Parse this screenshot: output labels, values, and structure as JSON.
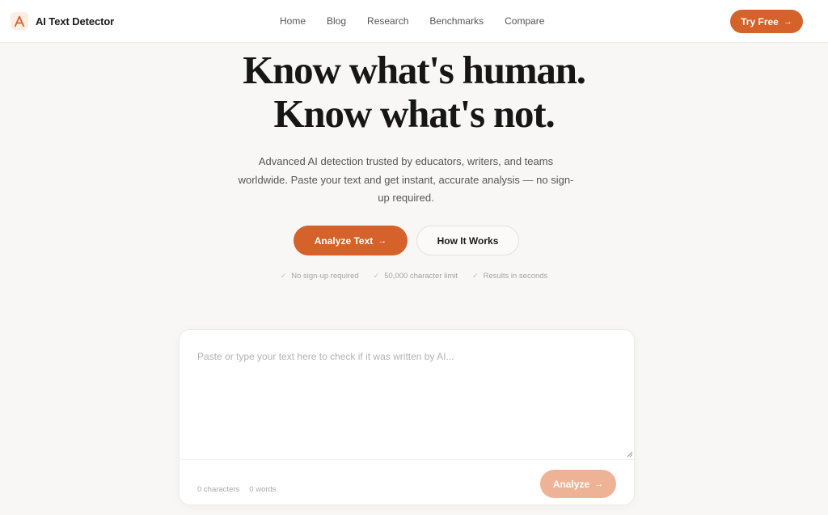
{
  "header": {
    "brand_name": "AI Text Detector",
    "logo_letter": "A",
    "nav": [
      "Home",
      "Blog",
      "Research",
      "Benchmarks",
      "Compare"
    ],
    "cta_label": "Try Free",
    "cta_icon": "arrow-right-icon"
  },
  "hero": {
    "title_line1": "Know what's human.",
    "title_line2": "Know what's not.",
    "subtitle": "Advanced AI detection trusted by educators, writers, and teams worldwide. Paste your text and get instant, accurate analysis — no sign-up required.",
    "primary_label": "Analyze Text",
    "secondary_label": "How It Works",
    "features": [
      "No sign-up required",
      "50,000 character limit",
      "Results in seconds"
    ]
  },
  "editor": {
    "placeholder": "Paste or type your text here to check if it was written by AI...",
    "value": "",
    "characters_label": "0 characters",
    "words_label": "0 words",
    "analyze_label": "Analyze"
  },
  "colors": {
    "accent": "#d4622a",
    "accent_disabled": "#eeb397",
    "background": "#f8f7f5"
  }
}
